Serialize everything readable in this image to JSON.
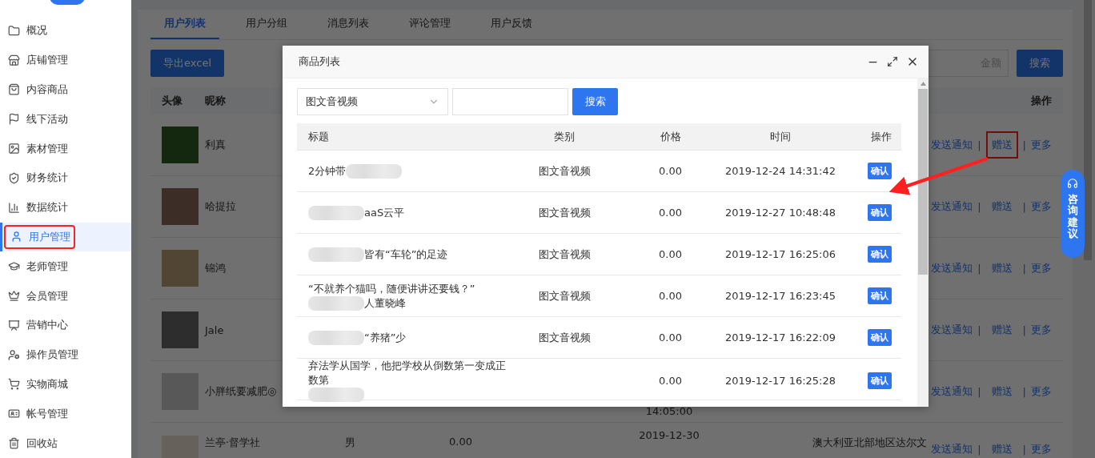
{
  "sidebar": {
    "items": [
      {
        "label": "概况",
        "selected": false
      },
      {
        "label": "店铺管理",
        "selected": false
      },
      {
        "label": "内容商品",
        "selected": false
      },
      {
        "label": "线下活动",
        "selected": false
      },
      {
        "label": "素材管理",
        "selected": false
      },
      {
        "label": "财务统计",
        "selected": false
      },
      {
        "label": "数据统计",
        "selected": false
      },
      {
        "label": "用户管理",
        "selected": true
      },
      {
        "label": "老师管理",
        "selected": false
      },
      {
        "label": "会员管理",
        "selected": false
      },
      {
        "label": "营销中心",
        "selected": false
      },
      {
        "label": "操作员管理",
        "selected": false
      },
      {
        "label": "实物商城",
        "selected": false
      },
      {
        "label": "帐号管理",
        "selected": false
      },
      {
        "label": "回收站",
        "selected": false
      }
    ]
  },
  "main": {
    "tabs": [
      {
        "label": "用户列表",
        "selected": true
      },
      {
        "label": "用户分组",
        "selected": false
      },
      {
        "label": "消息列表",
        "selected": false
      },
      {
        "label": "评论管理",
        "selected": false
      },
      {
        "label": "用户反馈",
        "selected": false
      }
    ],
    "export_button": "导出excel",
    "search": {
      "placeholder": "金额"
    },
    "search_button": "搜索",
    "table": {
      "columns": [
        "头像",
        "昵称",
        "操作"
      ],
      "separator": "|",
      "rows": [
        {
          "nickname": "利真",
          "actions": [
            "发送通知",
            "赠送",
            "更多"
          ],
          "gift_highlighted": true
        },
        {
          "nickname": "哈提拉",
          "actions": [
            "发送通知",
            "赠送",
            "更多"
          ],
          "gift_highlighted": false
        },
        {
          "nickname": "锦鸿",
          "actions": [
            "发送通知",
            "赠送",
            "更多"
          ],
          "gift_highlighted": false
        },
        {
          "nickname": "Jale",
          "actions": [
            "发送通知",
            "赠送",
            "更多"
          ],
          "gift_highlighted": false
        },
        {
          "nickname": "小胖纸要减肥◎",
          "actions": [
            "发送通知",
            "赠送",
            "更多"
          ],
          "gift_highlighted": false,
          "time": {
            "kind": "clock",
            "text": "14:05:00"
          }
        },
        {
          "nickname": "兰亭·督学社",
          "gender": "男",
          "amount": "0.00",
          "time": {
            "kind": "date",
            "text": "2019-12-30"
          },
          "region": "澳大利亚北部地区达尔文",
          "actions": [
            "发送通知",
            "赠送",
            "更多"
          ],
          "gift_highlighted": false
        }
      ]
    }
  },
  "modal": {
    "title": "商品列表",
    "select": {
      "value": "图文音视频"
    },
    "search_button": "搜索",
    "columns": [
      "标题",
      "类别",
      "价格",
      "时间",
      "操作"
    ],
    "rows": [
      {
        "title": [
          {
            "kind": "text",
            "text": "2分钟带"
          },
          {
            "kind": "blur"
          }
        ],
        "category": "图文音视频",
        "price": "0.00",
        "time": "2019-12-24 14:31:42",
        "action": "确认"
      },
      {
        "title": [
          {
            "kind": "blur"
          },
          {
            "kind": "text",
            "text": "aaS云平"
          }
        ],
        "category": "图文音视频",
        "price": "0.00",
        "time": "2019-12-27 10:48:48",
        "action": "确认"
      },
      {
        "title": [
          {
            "kind": "blur"
          },
          {
            "kind": "text",
            "text": "皆有“车轮”的足迹"
          }
        ],
        "category": "图文音视频",
        "price": "0.00",
        "time": "2019-12-17 16:25:06",
        "action": "确认"
      },
      {
        "title": [
          {
            "kind": "text",
            "text": "“不就养个猫吗，随便讲讲还要钱？”"
          },
          {
            "kind": "blur"
          },
          {
            "kind": "text",
            "text": "人董晓峰"
          }
        ],
        "category": "图文音视频",
        "price": "0.00",
        "time": "2019-12-17 16:23:45",
        "action": "确认"
      },
      {
        "title": [
          {
            "kind": "blur"
          },
          {
            "kind": "text",
            "text": "“养猪”少"
          }
        ],
        "category": "图文音视频",
        "price": "0.00",
        "time": "2019-12-17 16:22:09",
        "action": "确认"
      },
      {
        "title": [
          {
            "kind": "text",
            "text": "弃法学从国学，他把学校从倒数第一变成正数第"
          },
          {
            "kind": "blur"
          }
        ],
        "price": "0.00",
        "time": "2019-12-17 16:25:28",
        "action": "确认"
      }
    ]
  },
  "consult_button": "咨询建议"
}
